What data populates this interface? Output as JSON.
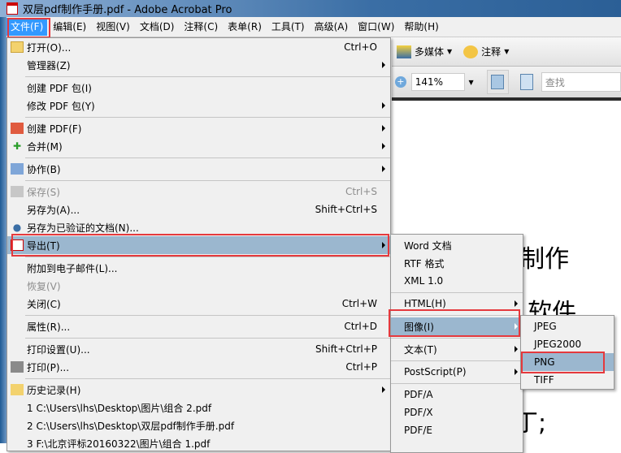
{
  "window": {
    "title": "双层pdf制作手册.pdf - Adobe Acrobat Pro"
  },
  "menubar": [
    "文件(F)",
    "编辑(E)",
    "视图(V)",
    "文档(D)",
    "注释(C)",
    "表单(R)",
    "工具(T)",
    "高级(A)",
    "窗口(W)",
    "帮助(H)"
  ],
  "toolbar": {
    "multimedia": "多媒体",
    "comment": "注释",
    "zoom": "141%",
    "find_placeholder": "查找"
  },
  "document": {
    "line1": "pdf 制作",
    "line2": "Pro 软件",
    "line3": "丁;"
  },
  "file_menu": {
    "open": {
      "label": "打开(O)...",
      "shortcut": "Ctrl+O"
    },
    "organizer": "管理器(Z)",
    "create_package": "创建 PDF 包(I)",
    "modify_package": "修改 PDF 包(Y)",
    "create_pdf": "创建 PDF(F)",
    "combine": "合并(M)",
    "collaborate": "协作(B)",
    "save": {
      "label": "保存(S)",
      "shortcut": "Ctrl+S"
    },
    "save_as": {
      "label": "另存为(A)...",
      "shortcut": "Shift+Ctrl+S"
    },
    "save_certified": "另存为已验证的文档(N)...",
    "export": "导出(T)",
    "attach_email": "附加到电子邮件(L)...",
    "revert": "恢复(V)",
    "close": {
      "label": "关闭(C)",
      "shortcut": "Ctrl+W"
    },
    "properties": {
      "label": "属性(R)...",
      "shortcut": "Ctrl+D"
    },
    "print_setup": {
      "label": "打印设置(U)...",
      "shortcut": "Shift+Ctrl+P"
    },
    "print": {
      "label": "打印(P)...",
      "shortcut": "Ctrl+P"
    },
    "history": "历史记录(H)",
    "recent": [
      "1 C:\\Users\\lhs\\Desktop\\图片\\组合 2.pdf",
      "2 C:\\Users\\lhs\\Desktop\\双层pdf制作手册.pdf",
      "3 F:\\北京评标20160322\\图片\\组合 1.pdf"
    ]
  },
  "export_menu": {
    "word": "Word 文档",
    "rtf": "RTF 格式",
    "xml": "XML 1.0",
    "html": "HTML(H)",
    "image": "图像(I)",
    "text": "文本(T)",
    "postscript": "PostScript(P)",
    "pdfa": "PDF/A",
    "pdfx": "PDF/X",
    "pdfe": "PDF/E"
  },
  "image_menu": [
    "JPEG",
    "JPEG2000",
    "PNG",
    "TIFF"
  ]
}
